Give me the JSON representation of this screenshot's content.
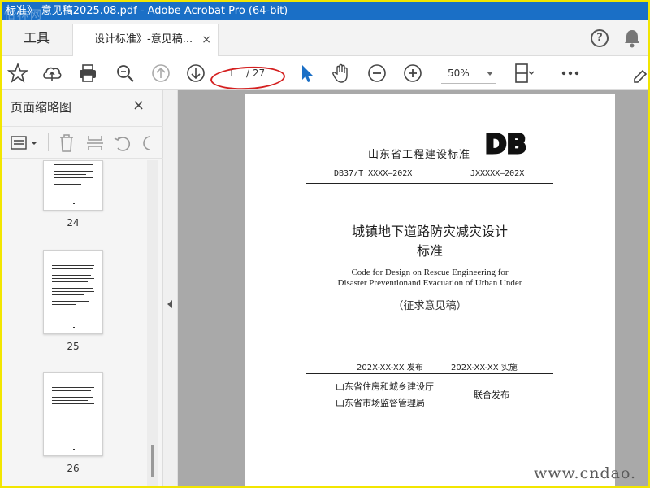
{
  "window": {
    "title": "标准》-意见稿2025.08.pdf - Adobe Acrobat Pro (64-bit)",
    "watermark_logo": "悟林网"
  },
  "tabs": {
    "tools_label": "工具",
    "document_label": "设计标准》-意见稿...",
    "close_glyph": "×"
  },
  "header_icons": [
    "help-icon",
    "bell-icon"
  ],
  "toolbar": {
    "icons": [
      "star-icon",
      "cloud-upload-icon",
      "print-icon",
      "zoom-search-icon",
      "arrow-up-circle-icon",
      "arrow-down-circle-icon",
      "select-cursor-icon",
      "hand-icon",
      "zoom-out-icon",
      "zoom-in-icon",
      "page-fit-icon",
      "more-icon"
    ],
    "current_page": "1",
    "total_pages": "/ 27",
    "zoom": "50%",
    "accent_color": "#1a6fc6"
  },
  "sidebar": {
    "title": "页面缩略图",
    "close_glyph": "×",
    "tool_icons": [
      "thumbnail-options-icon",
      "delete-icon",
      "extract-icon",
      "rotate-left-icon",
      "rotate-right-icon"
    ],
    "thumbnails": [
      {
        "label": "24"
      },
      {
        "label": "25"
      },
      {
        "label": "26"
      }
    ]
  },
  "document": {
    "header": "山东省工程建设标准",
    "logo_text": "DB",
    "code_left": "DB37/T XXXX—202X",
    "code_right": "JXXXXX—202X",
    "title_line1": "城镇地下道路防灾减灾设计",
    "title_line2": "标准",
    "english_line1": "Code for Design on Rescue Engineering for",
    "english_line2": "Disaster Preventionand Evacuation of Urban Under",
    "draft_label": "（征求意见稿）",
    "issue_date": "202X-XX-XX 发布",
    "implement_date": "202X-XX-XX 实施",
    "publisher1": "山东省住房和城乡建设厅",
    "publisher2": "山东省市场监督管理局",
    "joint_release": "联合发布"
  },
  "site_watermark": "www.cndao."
}
